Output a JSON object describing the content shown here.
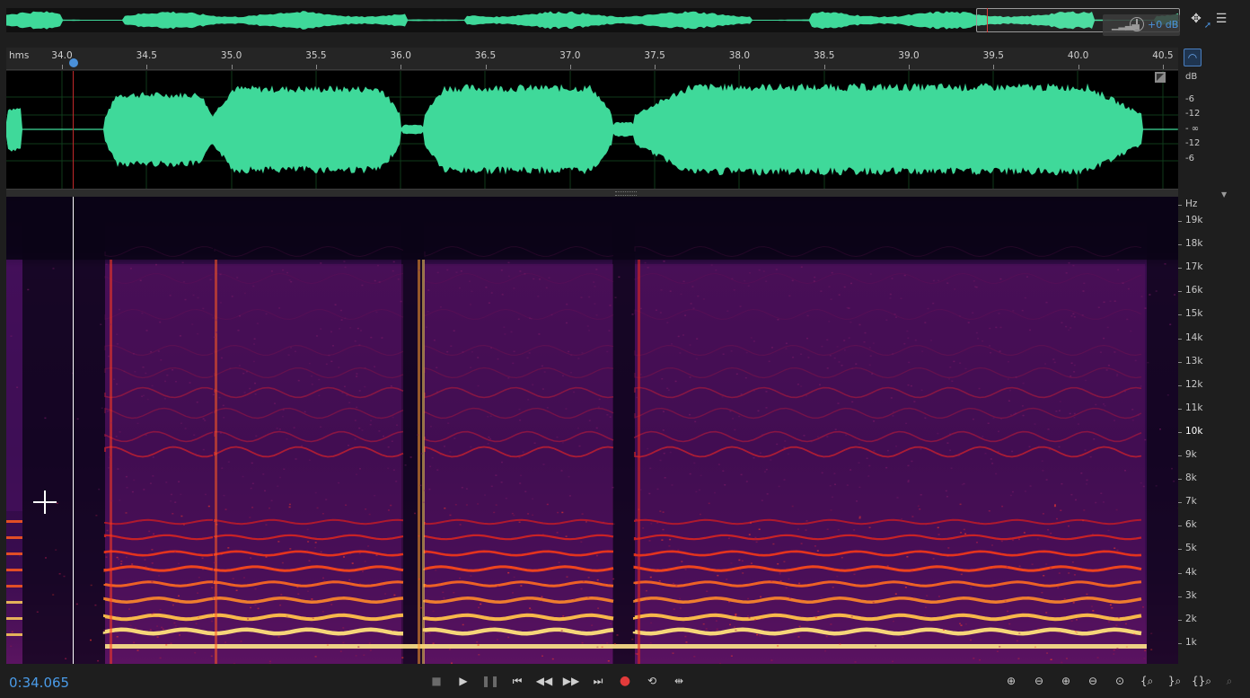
{
  "overview": {
    "db_readout": "+0 dB",
    "meter_icon": "level-bars-icon",
    "knob_icon": "volume-knob-icon"
  },
  "toolbar_icons": [
    "move-icon",
    "pin-icon",
    "panel-menu-icon",
    "headphones-icon"
  ],
  "ruler": {
    "unit": "hms",
    "ticks": [
      "34.0",
      "34.5",
      "35.0",
      "35.5",
      "36.0",
      "36.5",
      "37.0",
      "37.5",
      "38.0",
      "38.5",
      "39.0",
      "39.5",
      "40.0",
      "40.5"
    ]
  },
  "db_scale": {
    "header": "dB",
    "labels": [
      "-6",
      "-12",
      "- ∞",
      "-12",
      "-6"
    ]
  },
  "hz_scale": {
    "header": "Hz",
    "labels": [
      "19k",
      "18k",
      "17k",
      "16k",
      "15k",
      "14k",
      "13k",
      "12k",
      "11k",
      "10k",
      "9k",
      "8k",
      "7k",
      "6k",
      "5k",
      "4k",
      "3k",
      "2k",
      "1k"
    ]
  },
  "transport": {
    "timecode": "0:34.065",
    "buttons": [
      {
        "name": "stop-button",
        "icon": "■",
        "enabled": false
      },
      {
        "name": "play-button",
        "icon": "▶",
        "enabled": true
      },
      {
        "name": "pause-button",
        "icon": "❚❚",
        "enabled": false
      },
      {
        "name": "go-to-start-button",
        "icon": "⏮",
        "enabled": true
      },
      {
        "name": "rewind-button",
        "icon": "◀◀",
        "enabled": true
      },
      {
        "name": "fast-forward-button",
        "icon": "▶▶",
        "enabled": true
      },
      {
        "name": "go-to-end-button",
        "icon": "⏭",
        "enabled": true
      },
      {
        "name": "record-button",
        "icon": "●",
        "enabled": true
      },
      {
        "name": "loop-button",
        "icon": "⟲",
        "enabled": true
      },
      {
        "name": "skip-selection-button",
        "icon": "⇹",
        "enabled": true
      }
    ]
  },
  "zoom_controls": [
    {
      "name": "zoom-in-amplitude-button",
      "icon": "⊕",
      "enabled": true
    },
    {
      "name": "zoom-out-amplitude-button",
      "icon": "⊖",
      "enabled": true
    },
    {
      "name": "zoom-in-time-button",
      "icon": "⊕",
      "enabled": true
    },
    {
      "name": "zoom-out-time-button",
      "icon": "⊖",
      "enabled": true
    },
    {
      "name": "zoom-out-full-button",
      "icon": "⊙",
      "enabled": true
    },
    {
      "name": "zoom-in-left-button",
      "icon": "{⌕",
      "enabled": true
    },
    {
      "name": "zoom-in-right-button",
      "icon": "}⌕",
      "enabled": true
    },
    {
      "name": "zoom-selection-button",
      "icon": "{}⌕",
      "enabled": true
    },
    {
      "name": "zoom-reset-button",
      "icon": "⌕",
      "enabled": false
    }
  ],
  "colors": {
    "waveform": "#3fd99a",
    "accent": "#4a90d9",
    "playhead_wave": "#c0282a",
    "record": "#e23b3b"
  }
}
